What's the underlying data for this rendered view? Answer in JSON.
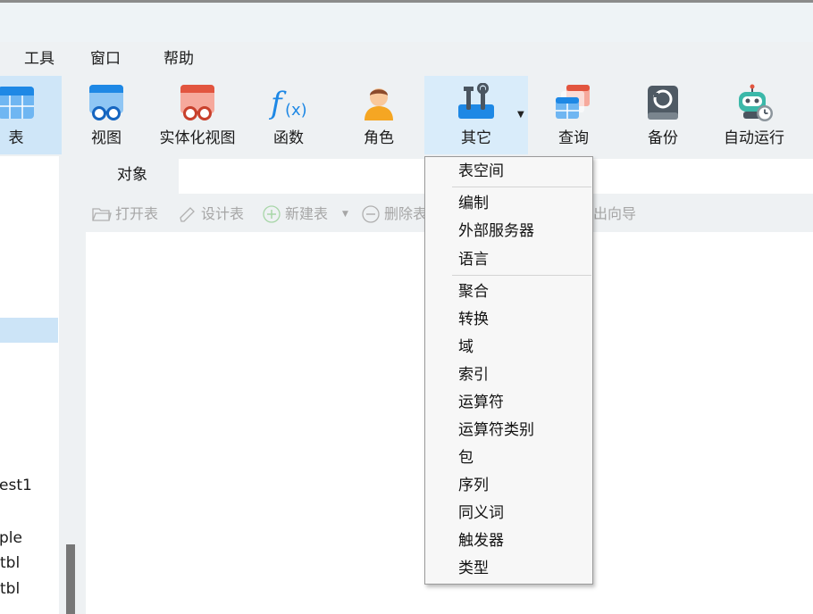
{
  "menu": {
    "items": [
      "工具",
      "窗口",
      "帮助"
    ]
  },
  "toolbar": {
    "buttons": [
      {
        "label": "表",
        "icon": "table-icon"
      },
      {
        "label": "视图",
        "icon": "view-icon"
      },
      {
        "label": "实体化视图",
        "icon": "materialized-view-icon"
      },
      {
        "label": "函数",
        "icon": "function-icon"
      },
      {
        "label": "角色",
        "icon": "role-icon"
      },
      {
        "label": "其它",
        "icon": "tools-icon"
      },
      {
        "label": "查询",
        "icon": "query-icon"
      },
      {
        "label": "备份",
        "icon": "backup-icon"
      },
      {
        "label": "自动运行",
        "icon": "robot-icon"
      }
    ]
  },
  "sidebar": {
    "items": [
      "est1",
      "ple",
      "tbl",
      "tbl"
    ]
  },
  "tabs": {
    "active": "对象"
  },
  "object_toolbar": {
    "open": "打开表",
    "design": "设计表",
    "new": "新建表",
    "delete": "删除表",
    "export_partial": "出向导"
  },
  "dropdown": {
    "groups": [
      [
        "表空间"
      ],
      [
        "编制",
        "外部服务器",
        "语言"
      ],
      [
        "聚合",
        "转换",
        "域",
        "索引",
        "运算符",
        "运算符类别",
        "包",
        "序列",
        "同义词",
        "触发器",
        "类型"
      ]
    ]
  },
  "colors": {
    "accent_blue": "#1e88e5",
    "accent_red": "#e2553f",
    "selection": "#cce4f7",
    "hover": "#d9ecfa"
  }
}
